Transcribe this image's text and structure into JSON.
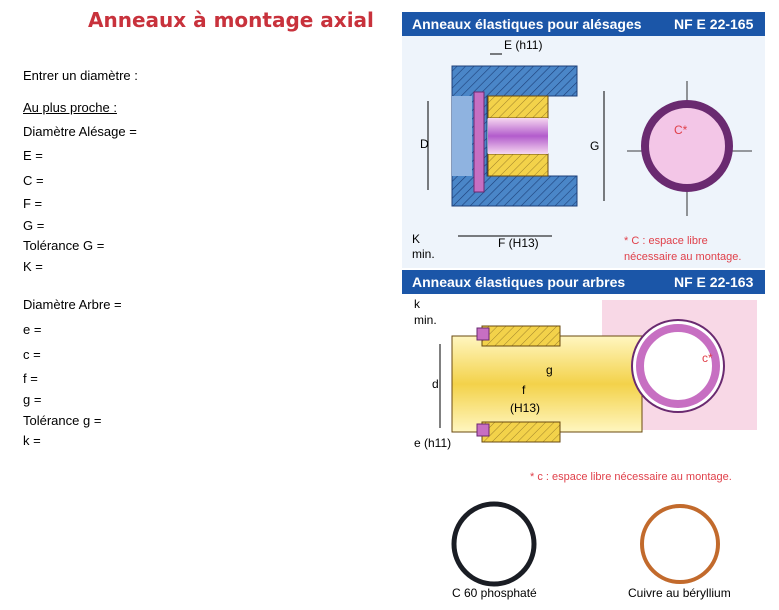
{
  "title": "Anneaux à montage axial",
  "form": {
    "prompt": "Entrer un diamètre :",
    "nearest": "Au plus proche :",
    "bore": {
      "diameter": "Diamètre Alésage =",
      "E": "E =",
      "C": "C =",
      "F": "F =",
      "G": "G =",
      "tolG": "Tolérance G  =",
      "K": "K ="
    },
    "shaft": {
      "diameter": "Diamètre Arbre =",
      "e": "e =",
      "c": "c =",
      "f": "f =",
      "g": "g =",
      "tolg": "Tolérance g  =",
      "k": "k ="
    }
  },
  "bore_panel": {
    "band_title": "Anneaux élastiques pour alésages",
    "standard": "NF E 22-165",
    "labels": {
      "E": "E (h11)",
      "D": "D",
      "G": "G",
      "K": "K",
      "min": "min.",
      "F": "F (H13)",
      "C": "C*"
    },
    "note_line1": "* C : espace libre",
    "note_line2": "nécessaire au montage."
  },
  "shaft_panel": {
    "band_title": "Anneaux élastiques pour arbres",
    "standard": "NF E 22-163",
    "labels": {
      "k": "k",
      "min": "min.",
      "d": "d",
      "g": "g",
      "f": "f",
      "H13": "(H13)",
      "e": "e (h11)",
      "c": "c*"
    },
    "note": "* c : espace libre nécessaire au montage."
  },
  "photos": {
    "left_caption": "C 60 phosphaté",
    "right_caption": "Cuivre au béryllium"
  },
  "colors": {
    "title": "#c8323c",
    "band": "#1b56a8",
    "steel_blue": "#4a86c8",
    "ring_pink": "#d9a0d0",
    "bronze_yellow": "#f3d24a",
    "note_red": "#e0404a"
  }
}
